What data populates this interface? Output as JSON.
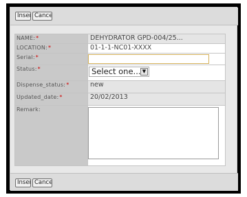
{
  "toolbar": {
    "insert_label": "Insert",
    "cancel_label": "Cancel"
  },
  "form": {
    "name": {
      "label": "NAME:",
      "required": "*",
      "value": "DEHYDRATOR GPD-004/25..."
    },
    "location": {
      "label": "LOCATION:",
      "required": "*",
      "value": "01-1-1-NC01-XXXX"
    },
    "serial": {
      "label": "Serial:",
      "required": "*",
      "value": ""
    },
    "status": {
      "label": "Status:",
      "required": "*",
      "selected": "Select one..."
    },
    "dispense_status": {
      "label": "Dispense_status:",
      "required": "*",
      "value": "new"
    },
    "updated_date": {
      "label": "Updated_date:",
      "required": "*",
      "value": "20/02/2013"
    },
    "remark": {
      "label": "Remark:",
      "value": ""
    }
  },
  "colors": {
    "required_mark": "#d00000",
    "label_bg": "#c9c9c9",
    "frame": "#000000"
  }
}
